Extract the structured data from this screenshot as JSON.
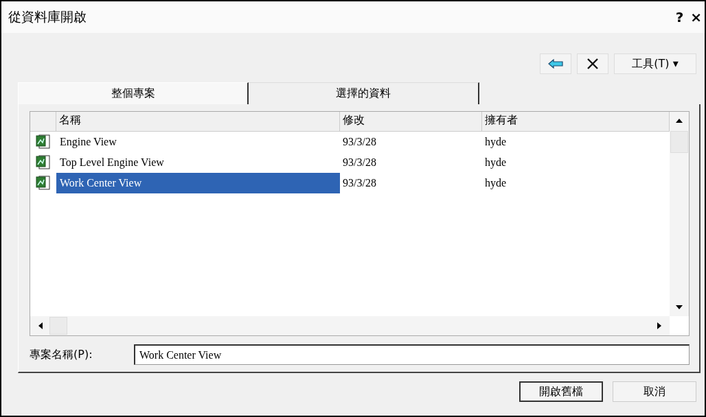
{
  "window": {
    "title": "從資料庫開啟",
    "help": "?",
    "close": "×"
  },
  "toolbar": {
    "tools_menu": {
      "label": "工具(T)",
      "caret": "▾"
    }
  },
  "tabs": [
    {
      "label": "整個專案",
      "selected": true
    },
    {
      "label": "選擇的資料",
      "selected": false
    }
  ],
  "table": {
    "columns": [
      "名稱",
      "修改",
      "擁有者"
    ],
    "rows": [
      {
        "name": "Engine View",
        "modified": "93/3/28",
        "owner": "hyde",
        "selected": false
      },
      {
        "name": "Top Level Engine View",
        "modified": "93/3/28",
        "owner": "hyde",
        "selected": false
      },
      {
        "name": "Work Center View",
        "modified": "93/3/28",
        "owner": "hyde",
        "selected": true
      }
    ]
  },
  "project_name": {
    "label": "專案名稱(P):",
    "value": "Work Center View"
  },
  "buttons": [
    "開啟舊檔",
    "取消"
  ]
}
